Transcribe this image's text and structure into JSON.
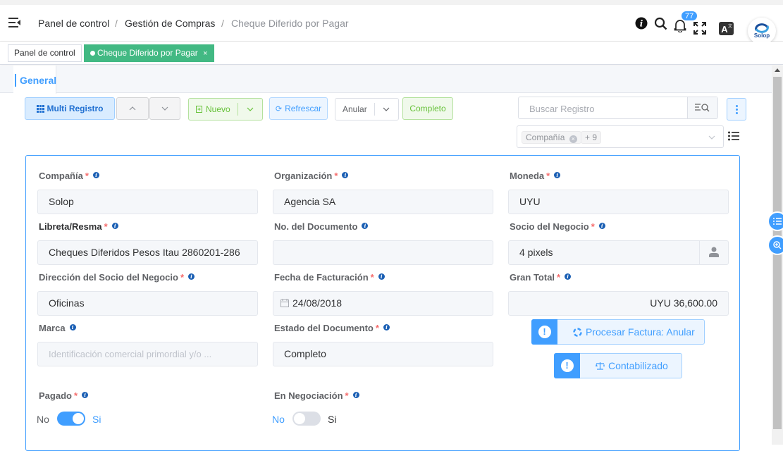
{
  "colors": {
    "accent": "#409eff",
    "active_tag": "#42b983",
    "required": "#f56c6c"
  },
  "header": {
    "breadcrumb": [
      "Panel de control",
      "Gestión de Compras",
      "Cheque Diferido por Pagar"
    ],
    "separator": "/",
    "notification_count": "77",
    "logo_text": "Solop",
    "icons": [
      "menu-icon",
      "info-icon",
      "search-icon",
      "bell-icon",
      "fullscreen-icon",
      "translate-icon"
    ]
  },
  "tags": [
    {
      "label": "Panel de control",
      "active": false
    },
    {
      "label": "Cheque Diferido por Pagar",
      "active": true,
      "close": "×"
    }
  ],
  "tabs": [
    {
      "label": "General"
    }
  ],
  "toolbar": {
    "multi_registro": "Multi Registro",
    "nuevo": "Nuevo",
    "refrescar": "Refrescar",
    "anular": "Anular",
    "completo": "Completo",
    "search_placeholder": "Buscar Registro",
    "filter_chip": "Compañía",
    "filter_more": "+ 9"
  },
  "form": {
    "compania": {
      "label": "Compañía",
      "value": "Solop"
    },
    "organizacion": {
      "label": "Organización",
      "value": "Agencia SA"
    },
    "moneda": {
      "label": "Moneda",
      "value": "UYU"
    },
    "libreta": {
      "label": "Libreta/Resma",
      "value": "Cheques Diferidos Pesos Itau 2860201-286"
    },
    "no_documento": {
      "label": "No. del Documento",
      "value": ""
    },
    "socio": {
      "label": "Socio del Negocio",
      "value": "4 pixels"
    },
    "direccion": {
      "label": "Dirección del Socio del Negocio",
      "value": "Oficinas"
    },
    "fecha": {
      "label": "Fecha de Facturación",
      "value": "24/08/2018"
    },
    "gran_total": {
      "label": "Gran Total",
      "value": "UYU 36,600.00"
    },
    "marca": {
      "label": "Marca",
      "placeholder": "Identificación comercial primordial y/o ..."
    },
    "estado": {
      "label": "Estado del Documento",
      "value": "Completo"
    },
    "procesar": {
      "label": "Procesar Factura: Anular"
    },
    "contabilizado": {
      "label": "Contabilizado"
    },
    "pagado": {
      "label": "Pagado",
      "off": "No",
      "on": "Si",
      "value": true
    },
    "negociacion": {
      "label": "En Negociación",
      "off": "No",
      "on": "Si",
      "value": false
    }
  }
}
